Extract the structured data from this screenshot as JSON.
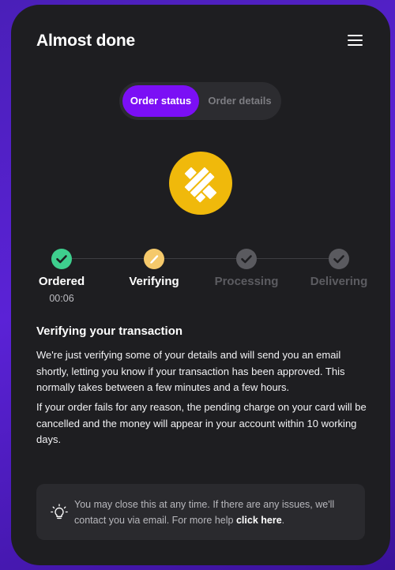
{
  "header": {
    "title": "Almost done",
    "menu_icon": "hamburger-menu-icon"
  },
  "tabs": [
    {
      "label": "Order status",
      "active": true
    },
    {
      "label": "Order details",
      "active": false
    }
  ],
  "coin": {
    "icon": "binance-usd-coin-icon",
    "color": "#f0b90b"
  },
  "steps": [
    {
      "label": "Ordered",
      "time": "00:06",
      "state": "done"
    },
    {
      "label": "Verifying",
      "state": "current"
    },
    {
      "label": "Processing",
      "state": "pending"
    },
    {
      "label": "Delivering",
      "state": "pending"
    }
  ],
  "content": {
    "heading": "Verifying your transaction",
    "paragraph1": "We're just verifying some of your details and will send you an email shortly, letting you know if your transaction has been approved. This normally takes between a few minutes and a few hours.",
    "paragraph2": "If your order fails for any reason, the pending charge on your card will be cancelled and the money will appear in your account within 10 working days."
  },
  "hint": {
    "icon": "lightbulb-icon",
    "text": "You may close this at any time. If there are any issues, we'll contact you via email. For more help",
    "link": "click here",
    "suffix": "."
  },
  "colors": {
    "accent": "#7b0ff5",
    "done": "#3ecf8e",
    "current": "#f5c96b",
    "pending": "#5a5a5f",
    "card": "#1e1e21"
  }
}
